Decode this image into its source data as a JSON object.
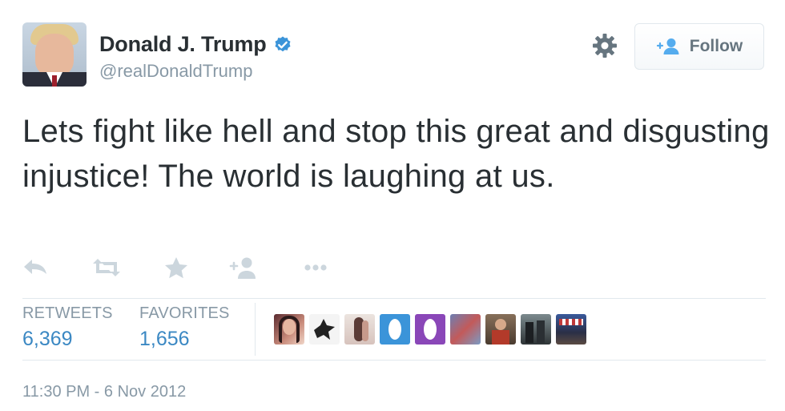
{
  "user": {
    "display_name": "Donald J. Trump",
    "handle": "@realDonaldTrump"
  },
  "follow_button": {
    "label": "Follow"
  },
  "tweet": {
    "text": "Lets fight like hell and stop this great and disgusting injustice! The world is laughing at us."
  },
  "stats": {
    "retweets_label": "RETWEETS",
    "retweets_value": "6,369",
    "favorites_label": "FAVORITES",
    "favorites_value": "1,656"
  },
  "timestamp": "11:30 PM - 6 Nov 2012",
  "icons": {
    "verified": "verified-badge-icon",
    "settings": "gear-icon",
    "follow": "add-user-icon",
    "reply": "reply-icon",
    "retweet": "retweet-icon",
    "favorite": "star-icon",
    "follow_action": "add-user-icon",
    "more": "more-dots-icon"
  },
  "colors": {
    "verified_blue": "#3b94d9",
    "accent_blue": "#3b88c3",
    "muted_gray": "#8899a6",
    "action_gray": "#ccd6dd",
    "follow_icon_blue": "#55acee"
  }
}
